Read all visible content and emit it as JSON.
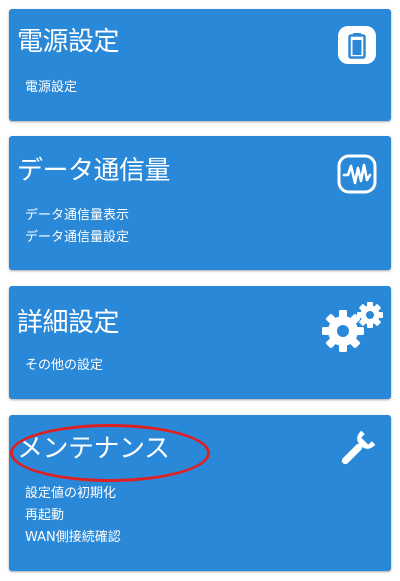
{
  "theme": {
    "card_color": "#2a88d8",
    "text_color": "#ffffff",
    "highlight_color": "#e02020"
  },
  "cards": [
    {
      "title": "電源設定",
      "icon": "battery-icon",
      "items": [
        "電源設定"
      ]
    },
    {
      "title": "データ通信量",
      "icon": "waveform-icon",
      "items": [
        "データ通信量表示",
        "データ通信量設定"
      ]
    },
    {
      "title": "詳細設定",
      "icon": "gears-icon",
      "items": [
        "その他の設定"
      ]
    },
    {
      "title": "メンテナンス",
      "icon": "wrench-icon",
      "items": [
        "設定値の初期化",
        "再起動",
        "WAN側接続確認"
      ]
    }
  ]
}
